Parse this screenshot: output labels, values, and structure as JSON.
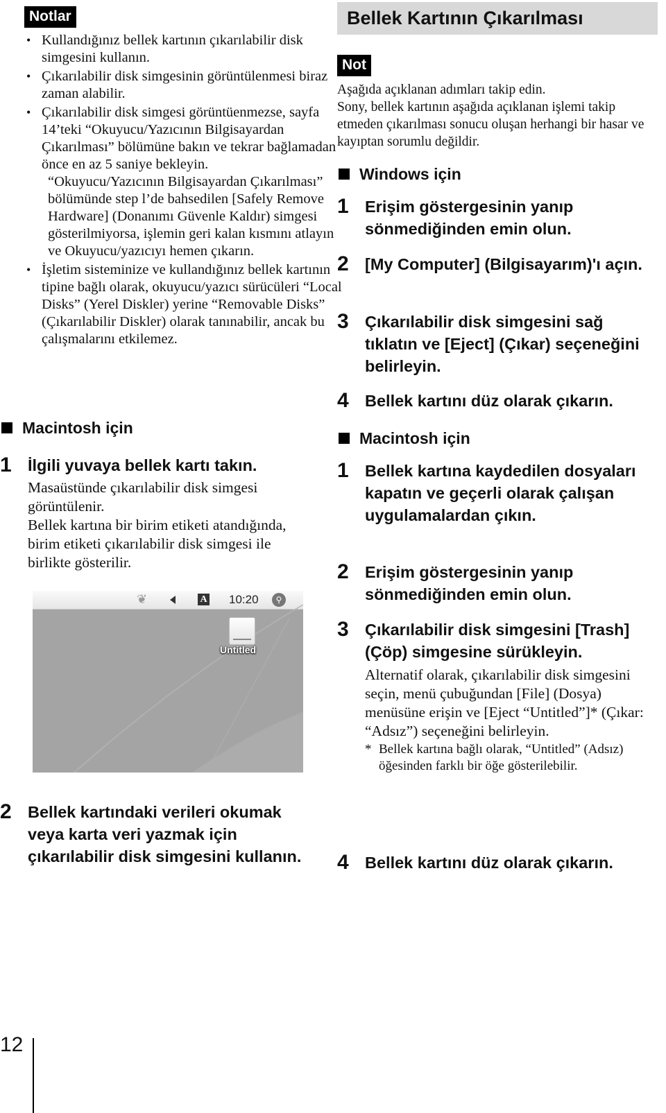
{
  "left": {
    "notes_tag": "Notlar",
    "notes": [
      {
        "paras": [
          "Kullandığınız bellek kartının çıkarılabilir disk simgesini kullanın."
        ]
      },
      {
        "paras": [
          "Çıkarılabilir disk simgesinin görüntülenmesi biraz zaman alabilir."
        ]
      },
      {
        "paras": [
          "Çıkarılabilir disk simgesi görüntüenmezse, sayfa 14’teki “Okuyucu/Yazıcının Bilgisayardan Çıkarılması” bölümüne bakın ve tekrar bağlamadan önce en az 5 saniye bekleyin.",
          "“Okuyucu/Yazıcının Bilgisayardan Çıkarılması” bölümünde step l’de bahsedilen [Safely Remove Hardware] (Donanımı Güvenle Kaldır) simgesi gösterilmiyorsa, işlemin geri kalan kısmını atlayın ve Okuyucu/yazıcıyı hemen çıkarın."
        ]
      },
      {
        "paras": [
          "İşletim sisteminize ve kullandığınız bellek kartının tipine bağlı olarak, okuyucu/yazıcı sürücüleri “Local Disks” (Yerel Diskler) yerine “Removable Disks” (Çıkarılabilir Diskler) olarak tanınabilir, ancak bu çalışmalarını etkilemez."
        ]
      }
    ],
    "mac_heading": "Macintosh için",
    "steps": [
      {
        "num": "1",
        "title": "İlgili yuvaya bellek kartı takın.",
        "body": [
          "Masaüstünde çıkarılabilir disk simgesi görüntülenir.",
          "Bellek kartına bir birim etiketi atandığında, birim etiketi çıkarılabilir disk simgesi ile birlikte gösterilir."
        ]
      },
      {
        "num": "2",
        "title": "Bellek kartındaki verileri okumak veya karta veri yazmak için çıkarılabilir disk simgesini kullanın.",
        "body": []
      }
    ],
    "screenshot": {
      "clock": "10:20",
      "disk_label": "Untitled",
      "menubar_icons": [
        "maple-leaf-icon",
        "speaker-icon",
        "input-menu-a-icon",
        "spotlight-search-icon"
      ]
    }
  },
  "right": {
    "title": "Bellek Kartının Çıkarılması",
    "note_tag": "Not",
    "note_text": [
      "Aşağıda açıklanan adımları takip edin.",
      "Sony, bellek kartının aşağıda açıklanan işlemi takip etmeden çıkarılması sonucu oluşan herhangi bir hasar ve kayıptan sorumlu değildir."
    ],
    "windows_heading": "Windows için",
    "windows_steps": [
      {
        "num": "1",
        "title": "Erişim göstergesinin yanıp sönmediğinden emin olun."
      },
      {
        "num": "2",
        "title": "[My Computer] (Bilgisayarım)'ı açın."
      },
      {
        "num": "3",
        "title": "Çıkarılabilir disk simgesini sağ tıklatın ve [Eject] (Çıkar) seçeneğini belirleyin."
      },
      {
        "num": "4",
        "title": "Bellek kartını düz olarak çıkarın."
      }
    ],
    "mac_heading": "Macintosh için",
    "mac_steps": [
      {
        "num": "1",
        "title": "Bellek kartına kaydedilen dosyaları kapatın ve geçerli olarak çalışan uygulamalardan çıkın."
      },
      {
        "num": "2",
        "title": "Erişim göstergesinin yanıp sönmediğinden emin olun."
      },
      {
        "num": "3",
        "title": "Çıkarılabilir disk simgesini [Trash] (Çöp) simgesine sürükleyin.",
        "body": "Alternatif olarak, çıkarılabilir disk simgesini seçin, menü çubuğundan [File] (Dosya) menüsüne erişin ve [Eject “Untitled”]* (Çıkar: “Adsız”) seçeneğini belirleyin.",
        "footnote_mark": "*",
        "footnote": "Bellek kartına bağlı olarak, “Untitled” (Adsız) öğesinden farklı bir öğe gösterilebilir."
      },
      {
        "num": "4",
        "title": "Bellek kartını düz olarak çıkarın."
      }
    ]
  },
  "page_number": "12"
}
